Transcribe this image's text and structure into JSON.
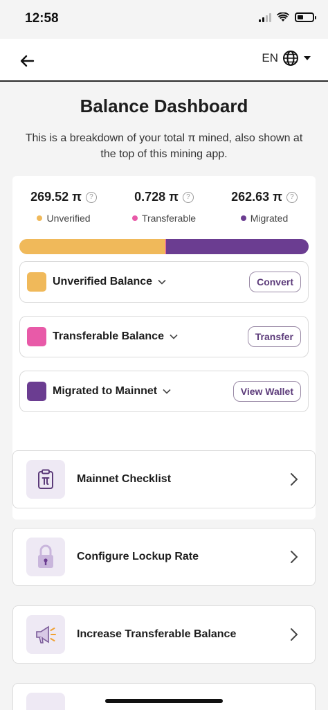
{
  "status_bar": {
    "time": "12:58"
  },
  "nav": {
    "language": "EN"
  },
  "page": {
    "title": "Balance Dashboard",
    "subtitle": "This is a breakdown of your total π mined, also shown at the top of this mining app."
  },
  "stats": [
    {
      "value": "269.52 π",
      "label": "Unverified",
      "color": "#f0b95a"
    },
    {
      "value": "0.728 π",
      "label": "Transferable",
      "color": "#e85aa8"
    },
    {
      "value": "262.63 π",
      "label": "Migrated",
      "color": "#6b3d91"
    }
  ],
  "progress": {
    "unverified_fraction": 0.505,
    "transferable_fraction": 0.0014,
    "migrated_fraction": 0.4936
  },
  "help_glyph": "?",
  "balances": [
    {
      "label": "Unverified Balance",
      "button": "Convert",
      "color": "#f0b95a"
    },
    {
      "label": "Transferable Balance",
      "button": "Transfer",
      "color": "#e85aa8"
    },
    {
      "label": "Migrated to Mainnet",
      "button": "View Wallet",
      "color": "#6b3d91"
    }
  ],
  "actions": [
    {
      "label": "Mainnet Checklist",
      "icon": "clipboard-pi-icon"
    },
    {
      "label": "Configure Lockup Rate",
      "icon": "padlock-icon"
    },
    {
      "label": "Increase Transferable Balance",
      "icon": "megaphone-icon"
    }
  ]
}
